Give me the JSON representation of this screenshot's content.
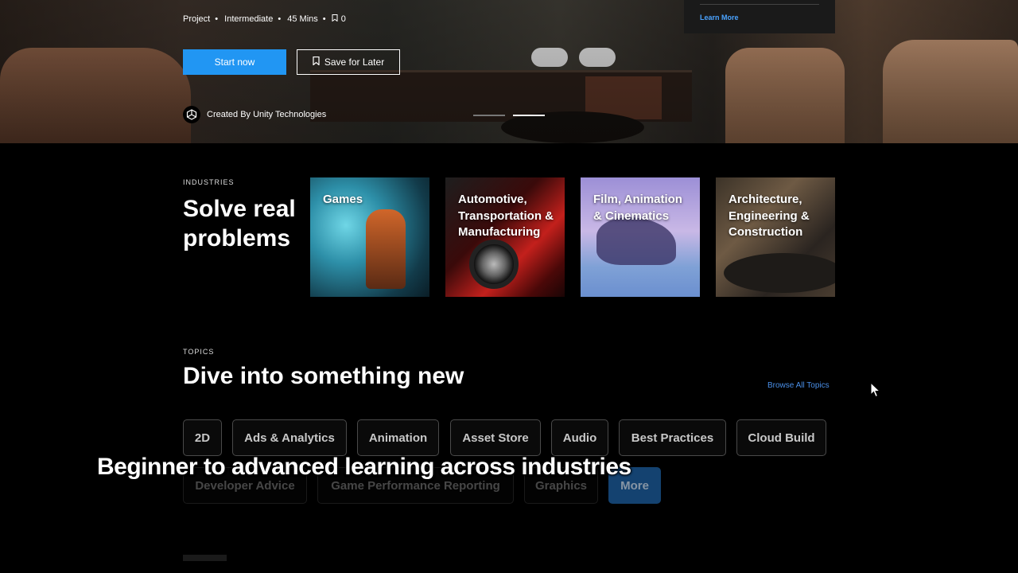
{
  "hero": {
    "meta": [
      "Project",
      "Intermediate",
      "45 Mins"
    ],
    "bookmark_count": "0",
    "start_label": "Start now",
    "save_label": "Save for Later",
    "creator": "Created By Unity Technologies",
    "learn_more": "Learn More",
    "slide_count": 2,
    "active_slide": 2
  },
  "industries": {
    "eyebrow": "INDUSTRIES",
    "title": "Solve real problems",
    "cards": [
      {
        "label": "Games"
      },
      {
        "label": "Automotive, Transportation & Manufacturing"
      },
      {
        "label": "Film, Animation & Cinematics"
      },
      {
        "label": "Architecture, Engineering & Construction"
      }
    ]
  },
  "topics": {
    "eyebrow": "TOPICS",
    "title": "Dive into something new",
    "browse_all": "Browse All Topics",
    "chips_row1": [
      "2D",
      "Ads & Analytics",
      "Animation",
      "Asset Store",
      "Audio",
      "Best Practices",
      "Cloud Build"
    ],
    "chips_row2": [
      "Developer Advice",
      "Game Performance Reporting",
      "Graphics"
    ],
    "more_label": "More"
  },
  "caption": "Beginner to advanced learning across industries",
  "colors": {
    "primary": "#2196f3",
    "link": "#4a8fe8",
    "background": "#000000"
  }
}
